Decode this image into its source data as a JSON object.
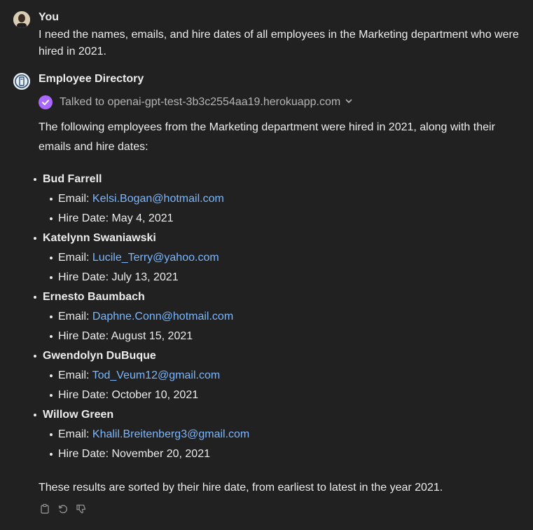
{
  "user": {
    "author": "You",
    "message": "I need the names, emails, and hire dates of all employees in the Marketing department who were hired in 2021."
  },
  "assistant": {
    "author": "Employee Directory",
    "tool_call": {
      "label": "Talked to openai-gpt-test-3b3c2554aa19.herokuapp.com",
      "icon": "check-icon",
      "accent": "#ab68ff"
    },
    "intro": "The following employees from the Marketing department were hired in 2021, along with their emails and hire dates:",
    "email_prefix": "Email: ",
    "hire_prefix": "Hire Date: ",
    "employees": [
      {
        "name": "Bud Farrell",
        "email": "Kelsi.Bogan@hotmail.com",
        "hire_date": "May 4, 2021"
      },
      {
        "name": "Katelynn Swaniawski",
        "email": "Lucile_Terry@yahoo.com",
        "hire_date": "July 13, 2021"
      },
      {
        "name": "Ernesto Baumbach",
        "email": "Daphne.Conn@hotmail.com",
        "hire_date": "August 15, 2021"
      },
      {
        "name": "Gwendolyn DuBuque",
        "email": "Tod_Veum12@gmail.com",
        "hire_date": "October 10, 2021"
      },
      {
        "name": "Willow Green",
        "email": "Khalil.Breitenberg3@gmail.com",
        "hire_date": "November 20, 2021"
      }
    ],
    "outro": "These results are sorted by their hire date, from earliest to latest in the year 2021.",
    "actions": [
      "copy-icon",
      "regenerate-icon",
      "thumbs-down-icon"
    ]
  },
  "colors": {
    "background": "#212121",
    "text": "#ececec",
    "muted": "#b4b4b4",
    "link": "#7ab7ff"
  }
}
